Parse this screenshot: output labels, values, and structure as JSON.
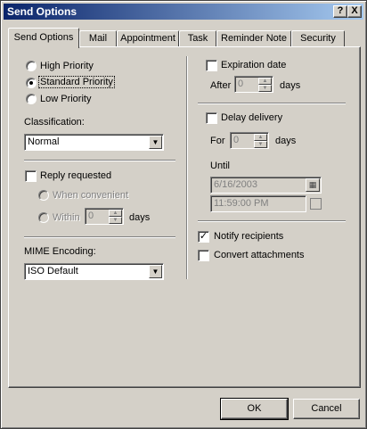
{
  "window": {
    "title": "Send Options",
    "help_glyph": "?",
    "close_glyph": "X"
  },
  "tabs": [
    {
      "label": "Send Options",
      "active": true
    },
    {
      "label": "Mail"
    },
    {
      "label": "Appointment"
    },
    {
      "label": "Task"
    },
    {
      "label": "Reminder Note"
    },
    {
      "label": "Security"
    }
  ],
  "priority": {
    "options": [
      "High Priority",
      "Standard Priority",
      "Low Priority"
    ],
    "selected": "Standard Priority"
  },
  "classification": {
    "label": "Classification:",
    "value": "Normal"
  },
  "reply": {
    "label": "Reply requested",
    "checked": false,
    "when_convenient": "When convenient",
    "within": "Within",
    "within_value": "0",
    "days": "days"
  },
  "mime": {
    "label": "MIME Encoding:",
    "value": "ISO Default"
  },
  "expiration": {
    "label": "Expiration date",
    "checked": false,
    "after": "After",
    "after_value": "0",
    "days": "days"
  },
  "delay": {
    "label": "Delay delivery",
    "checked": false,
    "for": "For",
    "for_value": "0",
    "days": "days",
    "until": "Until",
    "date_value": "6/16/2003",
    "time_value": "11:59:00 PM"
  },
  "notify": {
    "label": "Notify recipients",
    "checked": true
  },
  "convert": {
    "label": "Convert attachments",
    "checked": false
  },
  "buttons": {
    "ok": "OK",
    "cancel": "Cancel"
  }
}
